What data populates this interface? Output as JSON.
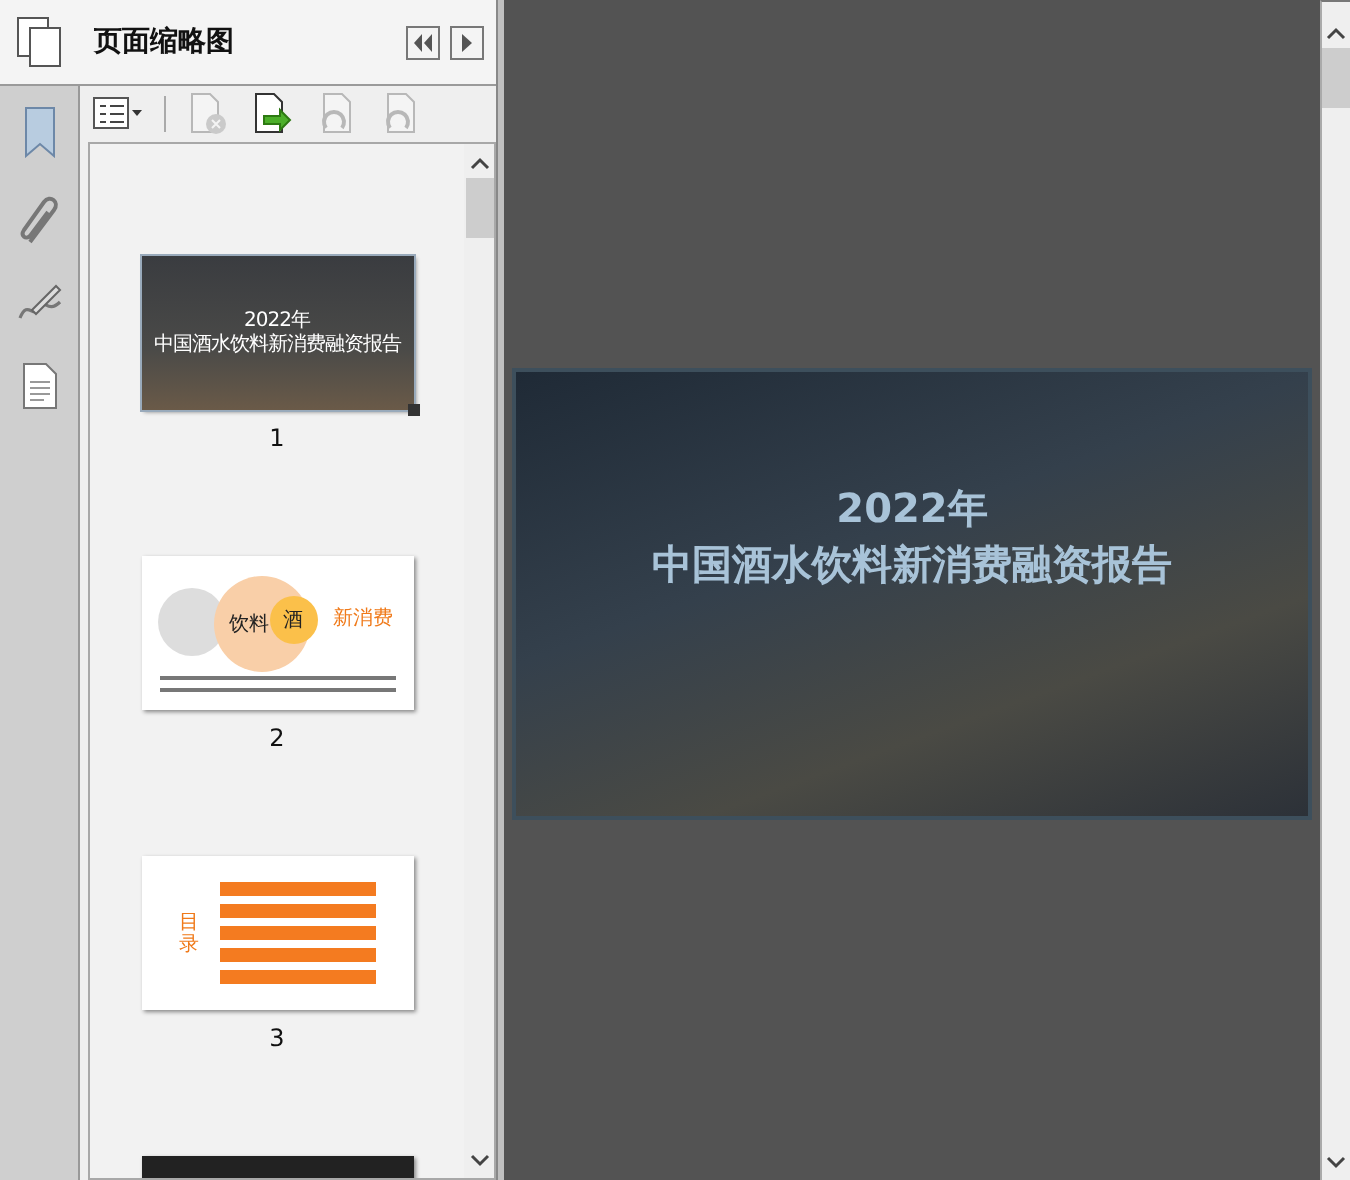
{
  "panel": {
    "title": "页面缩略图"
  },
  "toolbar": [
    {
      "kind": "options",
      "disabled": false
    },
    {
      "kind": "delete",
      "disabled": true
    },
    {
      "kind": "insert",
      "disabled": false
    },
    {
      "kind": "undo",
      "disabled": true
    },
    {
      "kind": "redo",
      "disabled": true
    }
  ],
  "thumbnails": [
    {
      "kind": "cover",
      "page": "1",
      "selected": true,
      "title_lines": [
        "2022年",
        "中国酒水饮料新消费融资报告"
      ]
    },
    {
      "kind": "venn",
      "page": "2",
      "selected": false,
      "labels": [
        "饮料",
        "酒",
        "新消费"
      ]
    },
    {
      "kind": "contents",
      "page": "3",
      "selected": false,
      "heading": "目录"
    },
    {
      "kind": "dark",
      "selected": false
    }
  ],
  "document": {
    "title_lines": [
      "2022年",
      "中国酒水饮料新消费融资报告"
    ]
  }
}
